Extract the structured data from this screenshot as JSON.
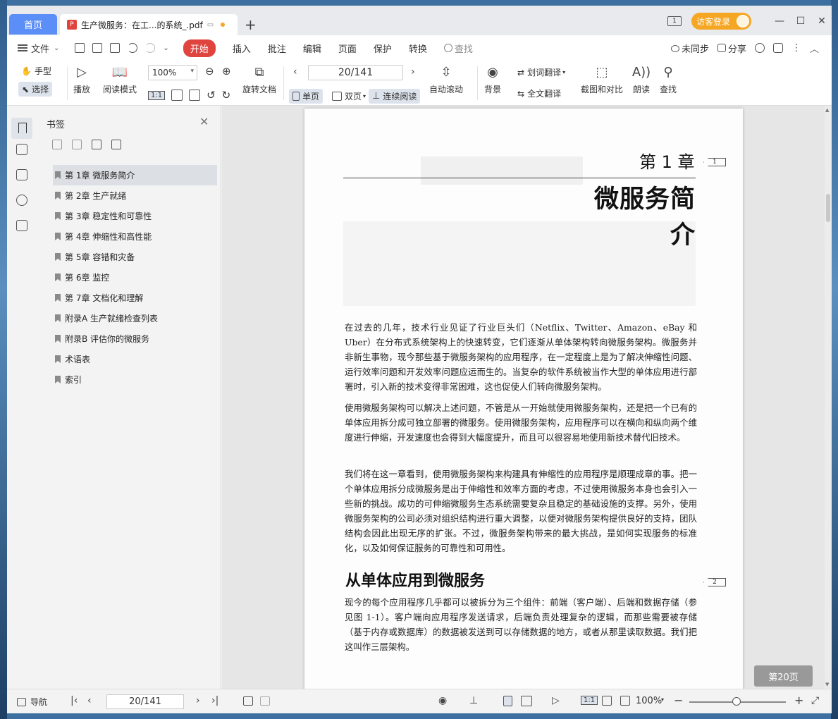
{
  "titlebar": {
    "home_tab": "首页",
    "doc_tab": "生产微服务：在工...的系统_.pdf",
    "new_tab": "+",
    "window_badge": "1",
    "login_button": "访客登录"
  },
  "menubar": {
    "file": "文件",
    "start": "开始",
    "items": [
      "插入",
      "批注",
      "编辑",
      "页面",
      "保护",
      "转换"
    ],
    "search_placeholder": "查找",
    "sync": "未同步",
    "share": "分享"
  },
  "toolbar": {
    "hand": "手型",
    "select": "选择",
    "play": "播放",
    "reading_mode": "阅读模式",
    "zoom": "100%",
    "rotate_doc": "旋转文档",
    "page_indicator": "20/141",
    "single_page": "单页",
    "double_page": "双页",
    "continuous": "连续阅读",
    "auto_scroll": "自动滚动",
    "background": "背景",
    "word_translate": "划词翻译",
    "full_translate": "全文翻译",
    "screenshot_compare": "截图和对比",
    "read_aloud": "朗读",
    "find": "查找",
    "fit_label": "1:1"
  },
  "bookmarks": {
    "title": "书签",
    "items": [
      {
        "label": "第 1章   微服务简介"
      },
      {
        "label": "第 2章   生产就绪"
      },
      {
        "label": "第 3章   稳定性和可靠性"
      },
      {
        "label": "第 4章   伸缩性和高性能"
      },
      {
        "label": "第 5章   容错和灾备"
      },
      {
        "label": "第 6章   监控"
      },
      {
        "label": "第 7章   文档化和理解"
      },
      {
        "label": "附录A   生产就绪检查列表"
      },
      {
        "label": "附录B   评估你的微服务"
      },
      {
        "label": "术语表"
      },
      {
        "label": "索引"
      }
    ]
  },
  "page": {
    "chapter_number": "第 1 章",
    "chapter_title": "微服务简介",
    "margin_marks": [
      "1",
      "2"
    ],
    "paragraphs": [
      "在过去的几年，技术行业见证了行业巨头们（Netflix、Twitter、Amazon、eBay 和 Uber）在分布式系统架构上的快速转变，它们逐渐从单体架构转向微服务架构。微服务并非新生事物，现今那些基于微服务架构的应用程序，在一定程度上是为了解决伸缩性问题、运行效率问题和开发效率问题应运而生的。当复杂的软件系统被当作大型的单体应用进行部署时，引入新的技术变得非常困难，这也促使人们转向微服务架构。",
      "使用微服务架构可以解决上述问题，不管是从一开始就使用微服务架构，还是把一个已有的单体应用拆分成可独立部署的微服务。使用微服务架构，应用程序可以在横向和纵向两个维度进行伸缩，开发速度也会得到大幅度提升，而且可以很容易地使用新技术替代旧技术。",
      "我们将在这一章看到，使用微服务架构来构建具有伸缩性的应用程序是顺理成章的事。把一个单体应用拆分成微服务是出于伸缩性和效率方面的考虑，不过使用微服务本身也会引入一些新的挑战。成功的可伸缩微服务生态系统需要复杂且稳定的基础设施的支撑。另外，使用微服务架构的公司必须对组织结构进行重大调整，以便对微服务架构提供良好的支持，团队结构会因此出现无序的扩张。不过，微服务架构带来的最大挑战，是如何实现服务的标准化，以及如何保证服务的可靠性和可用性。"
    ],
    "section_title": "从单体应用到微服务",
    "section_paragraph": "现今的每个应用程序几乎都可以被拆分为三个组件：前端（客户端）、后端和数据存储（参见图 1-1）。客户端向应用程序发送请求，后端负责处理复杂的逻辑，而那些需要被存储（基于内存或数据库）的数据被发送到可以存储数据的地方，或者从那里读取数据。我们把这叫作三层架构。",
    "page_badge": "第20页"
  },
  "statusbar": {
    "nav": "导航",
    "page_indicator": "20/141",
    "zoom": "100%",
    "fit_label": "1:1"
  }
}
